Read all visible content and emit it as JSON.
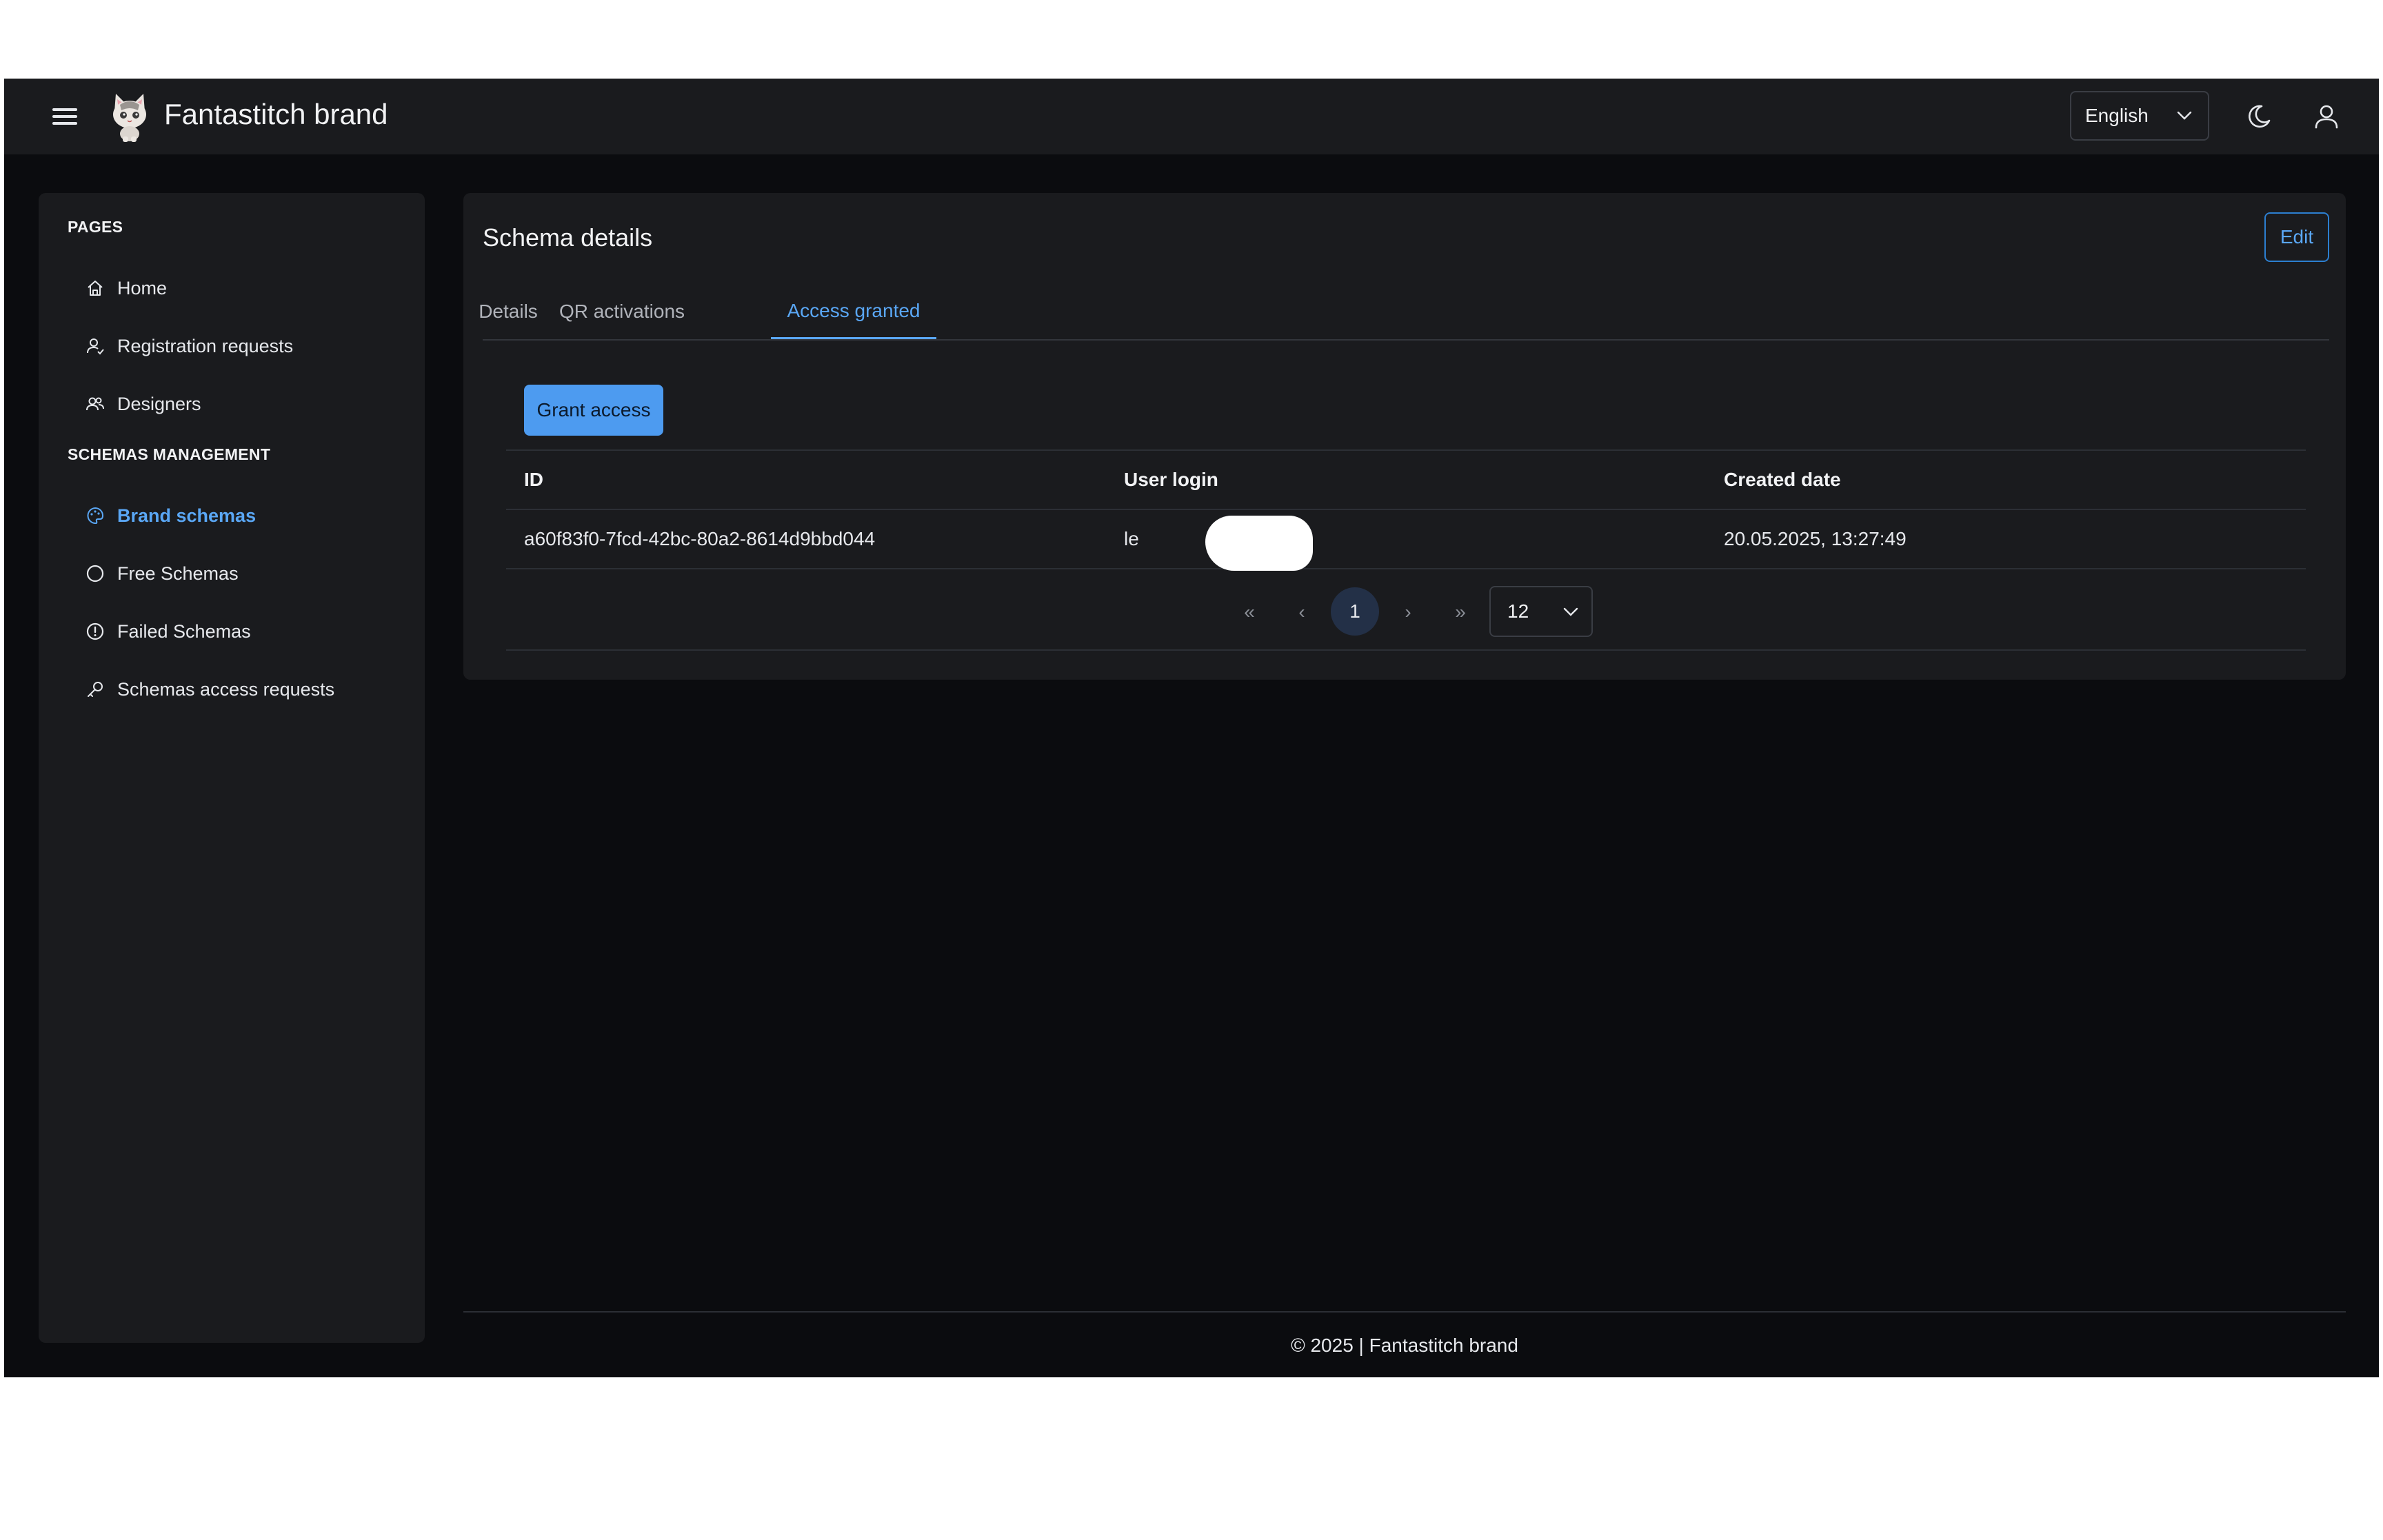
{
  "header": {
    "brand": "Fantastitch brand",
    "language": "English",
    "icons": {
      "menu": "hamburger-menu-icon",
      "theme": "moon-icon",
      "user": "user-icon"
    }
  },
  "sidebar": {
    "sections": [
      {
        "title": "PAGES",
        "items": [
          {
            "label": "Home",
            "icon": "home-icon",
            "active": false
          },
          {
            "label": "Registration requests",
            "icon": "user-check-icon",
            "active": false
          },
          {
            "label": "Designers",
            "icon": "users-icon",
            "active": false
          }
        ]
      },
      {
        "title": "SCHEMAS MANAGEMENT",
        "items": [
          {
            "label": "Brand schemas",
            "icon": "palette-icon",
            "active": true
          },
          {
            "label": "Free Schemas",
            "icon": "circle-icon",
            "active": false
          },
          {
            "label": "Failed Schemas",
            "icon": "alert-circle-icon",
            "active": false
          },
          {
            "label": "Schemas access requests",
            "icon": "key-icon",
            "active": false
          }
        ]
      }
    ]
  },
  "main": {
    "title": "Schema details",
    "edit_label": "Edit",
    "tabs": [
      {
        "label": "Details",
        "active": false
      },
      {
        "label": "QR activations",
        "active": false
      },
      {
        "label": "Access granted",
        "active": true
      }
    ],
    "grant_access_label": "Grant access",
    "table": {
      "columns": [
        "ID",
        "User login",
        "Created date"
      ],
      "rows": [
        {
          "id": "a60f83f0-7fcd-42bc-80a2-8614d9bbd044",
          "user_login": "le .com",
          "created": "20.05.2025, 13:27:49"
        }
      ]
    },
    "pagination": {
      "first": "«",
      "prev": "‹",
      "current_page": "1",
      "next": "›",
      "last": "»",
      "page_size": "12"
    }
  },
  "footer": {
    "text": "© 2025 | Fantastitch brand"
  },
  "colors": {
    "accent": "#5aa7f5",
    "button": "#4d9bf0",
    "background": "#0b0c0f",
    "panel": "#1a1b1e"
  }
}
